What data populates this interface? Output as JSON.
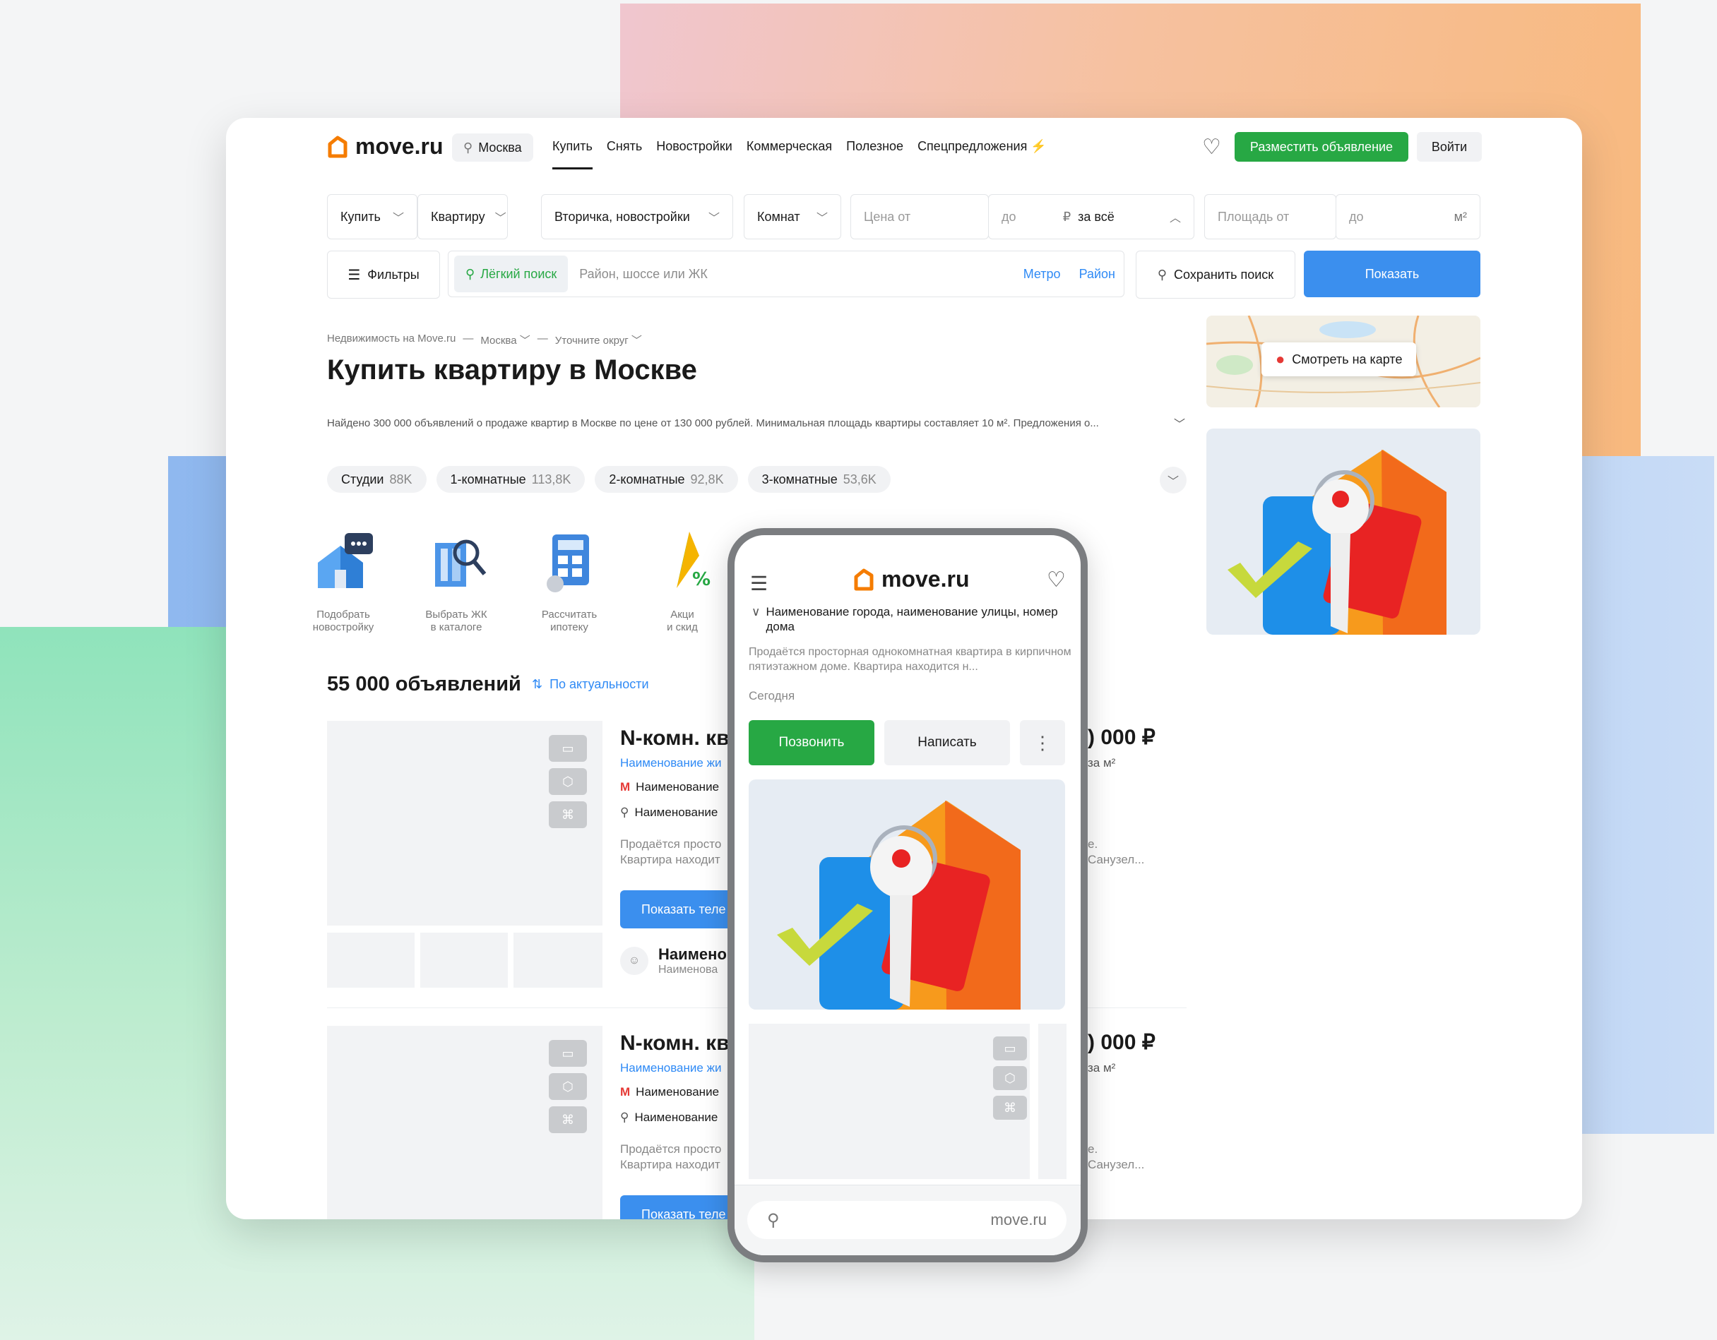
{
  "header": {
    "logo_text": "move.ru",
    "city": "Москва",
    "nav": [
      "Купить",
      "Снять",
      "Новостройки",
      "Коммерческая",
      "Полезное",
      "Спецпредложения"
    ],
    "post_ad": "Разместить объявление",
    "login": "Войти"
  },
  "search_filters": {
    "deal": "Купить",
    "property": "Квартиру",
    "market": "Вторичка, новостройки",
    "rooms": "Комнат",
    "price_from_ph": "Цена от",
    "price_to_ph": "до",
    "currency": "₽",
    "price_scope": "за всё",
    "area_from_ph": "Площадь от",
    "area_to_ph": "до",
    "area_unit": "м²",
    "filters": "Фильтры",
    "easy_search": "Лёгкий поиск",
    "search_ph": "Район, шоссе или ЖК",
    "metro": "Метро",
    "district": "Район",
    "save_search": "Сохранить поиск",
    "show": "Показать"
  },
  "breadcrumb": [
    "Недвижимость на Move.ru",
    "Москва",
    "Уточните округ"
  ],
  "page_title": "Купить квартиру в Москве",
  "found_text": "Найдено 300 000 объявлений о продаже квартир в Москве по цене от 130 000 рублей. Минимальная площадь квартиры составляет 10 м². Предложения о...",
  "room_chips": [
    {
      "label": "Студии",
      "count": "88K"
    },
    {
      "label": "1-комнатные",
      "count": "113,8K"
    },
    {
      "label": "2-комнатные",
      "count": "92,8K"
    },
    {
      "label": "3-комнатные",
      "count": "53,6K"
    }
  ],
  "tiles": [
    {
      "line1": "Подобрать",
      "line2": "новостройку"
    },
    {
      "line1": "Выбрать ЖК",
      "line2": "в каталоге"
    },
    {
      "line1": "Рассчитать",
      "line2": "ипотеку"
    },
    {
      "line1": "Акци",
      "line2": "и скид"
    }
  ],
  "listings": {
    "count": "55 000 объявлений",
    "sort": "По актуальности",
    "items": [
      {
        "title": "N-комн. кв",
        "complex": "Наименование жи",
        "metro": "Наименование",
        "address": "Наименование",
        "desc1": "Продаётся просто",
        "desc2": "Квартира находит",
        "phone": "Показать теле",
        "agent_name": "Наимено",
        "agent_sub": "Наименова",
        "price": ") 000 ₽",
        "per_m2": "за м²",
        "desc_right1": "е.",
        "desc_right2": "Санузел..."
      },
      {
        "title": "N-комн. кв",
        "complex": "Наименование жи",
        "metro": "Наименование",
        "address": "Наименование",
        "desc1": "Продаётся просто",
        "desc2": "Квартира находит",
        "phone": "Показать теле",
        "price": ") 000 ₽",
        "per_m2": "за м²",
        "desc_right1": "е.",
        "desc_right2": "Санузел..."
      }
    ]
  },
  "map_button": "Смотреть на карте",
  "phone": {
    "logo_text": "move.ru",
    "address": "Наименование города, наименование улицы, номер дома",
    "desc": "Продаётся просторная однокомнатная квартира в кирпичном пятиэтажном доме. Квартира находится н...",
    "date": "Сегодня",
    "call": "Позвонить",
    "write": "Написать",
    "url": "move.ru"
  },
  "colors": {
    "green": "#27a844",
    "blue": "#3b8fee",
    "link": "#2f8af5",
    "logo_orange": "#f57c00"
  }
}
